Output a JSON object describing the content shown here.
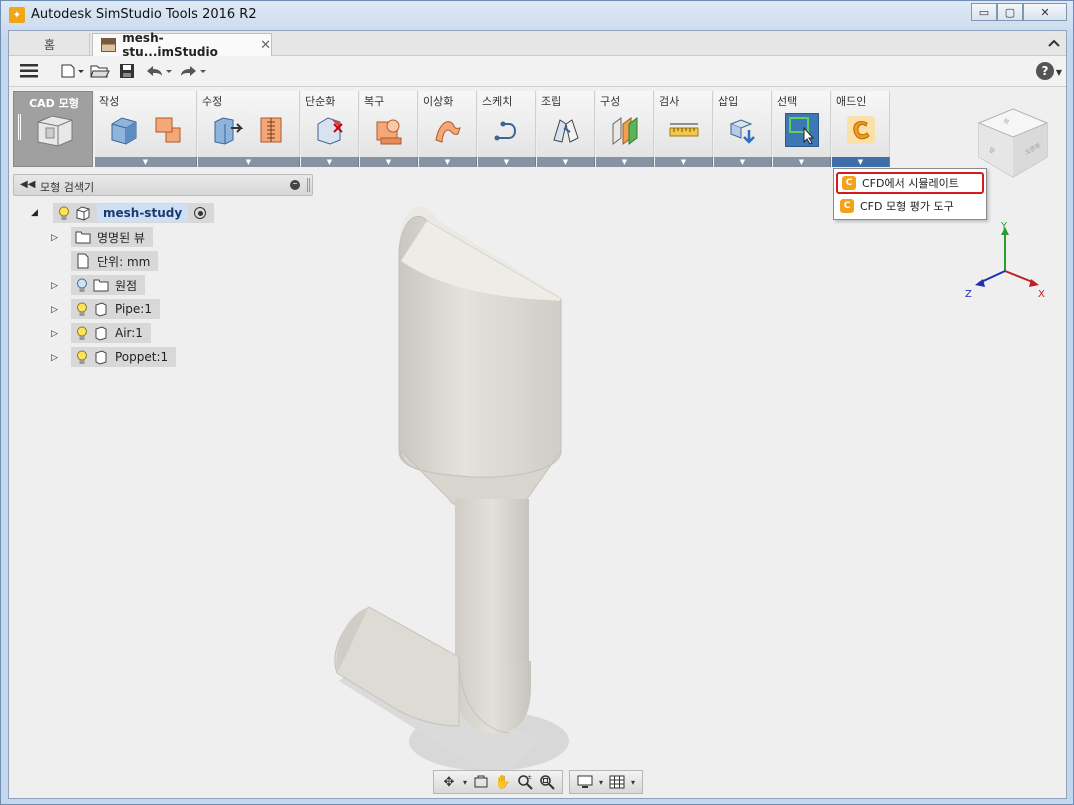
{
  "window": {
    "title": "Autodesk SimStudio Tools 2016 R2",
    "minimize": "▭",
    "maximize": "▢",
    "close": "✕"
  },
  "tabs": {
    "home": "홈",
    "document": "mesh-stu...imStudio",
    "close_glyph": "✕",
    "collapse_glyph": "︿"
  },
  "ribbon": {
    "workspace_label": "CAD 모형",
    "groups": [
      {
        "label": "작성"
      },
      {
        "label": "수정"
      },
      {
        "label": "단순화"
      },
      {
        "label": "복구"
      },
      {
        "label": "이상화"
      },
      {
        "label": "스케치"
      },
      {
        "label": "조립"
      },
      {
        "label": "구성"
      },
      {
        "label": "검사"
      },
      {
        "label": "삽입"
      },
      {
        "label": "선택"
      },
      {
        "label": "애드인"
      }
    ]
  },
  "addin_menu": {
    "items": [
      {
        "label": "CFD에서 시뮬레이트",
        "highlighted": true
      },
      {
        "label": "CFD 모형 평가 도구",
        "highlighted": false
      }
    ]
  },
  "browser": {
    "title": "모형 검색기",
    "root": "mesh-study",
    "items": [
      {
        "label": "명명된 뷰"
      },
      {
        "label": "단위: mm"
      },
      {
        "label": "원점"
      },
      {
        "label": "Pipe:1"
      },
      {
        "label": "Air:1"
      },
      {
        "label": "Poppet:1"
      }
    ]
  },
  "triad": {
    "x": "X",
    "y": "Y",
    "z": "Z"
  },
  "colors": {
    "accent_selected": "#3d78b5",
    "highlight_border": "#d11d1d",
    "addin_icon": "#f3a21c",
    "model_surface": "#dcdad4"
  }
}
